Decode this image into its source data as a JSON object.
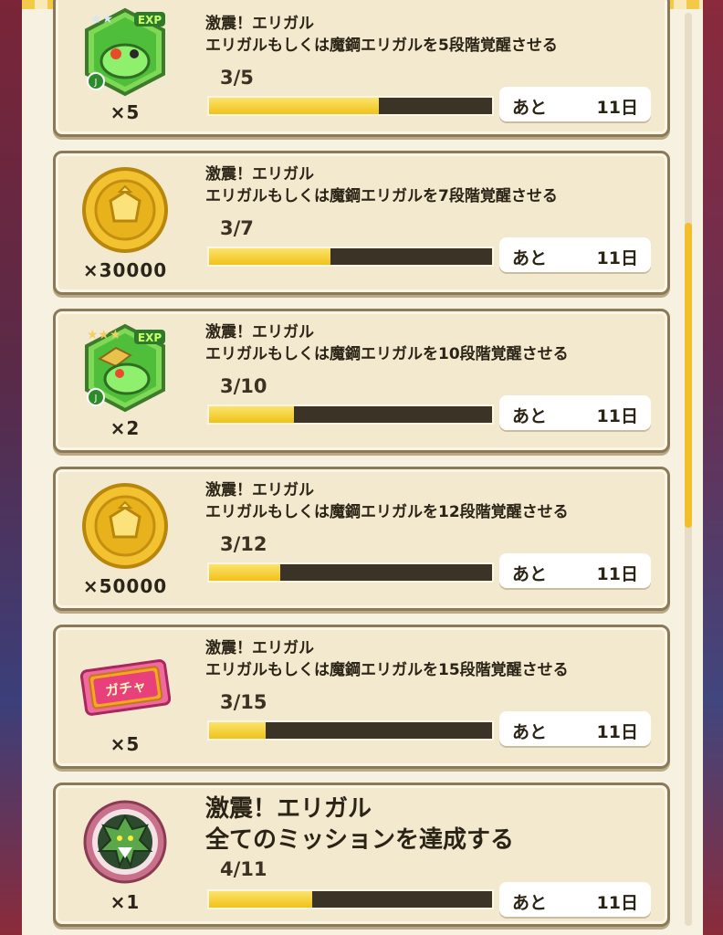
{
  "missions": [
    {
      "title": "激震！エリガル",
      "description": "エリガルもしくは魔鋼エリガルを5段階覚醒させる",
      "progress_text": "3/5",
      "progress": 0.6,
      "remaining_label": "あと",
      "remaining_days": "11日",
      "reward": {
        "type": "exp-monster-icon",
        "badge": "EXP",
        "quantity": "×5"
      }
    },
    {
      "title": "激震！エリガル",
      "description": "エリガルもしくは魔鋼エリガルを7段階覚醒させる",
      "progress_text": "3/7",
      "progress": 0.4286,
      "remaining_label": "あと",
      "remaining_days": "11日",
      "reward": {
        "type": "gold-coin-icon",
        "quantity": "×30000"
      }
    },
    {
      "title": "激震！エリガル",
      "description": "エリガルもしくは魔鋼エリガルを10段階覚醒させる",
      "progress_text": "3/10",
      "progress": 0.3,
      "remaining_label": "あと",
      "remaining_days": "11日",
      "reward": {
        "type": "exp-monster-icon",
        "badge": "EXP",
        "quantity": "×2"
      }
    },
    {
      "title": "激震！エリガル",
      "description": "エリガルもしくは魔鋼エリガルを12段階覚醒させる",
      "progress_text": "3/12",
      "progress": 0.25,
      "remaining_label": "あと",
      "remaining_days": "11日",
      "reward": {
        "type": "gold-coin-icon",
        "quantity": "×50000"
      }
    },
    {
      "title": "激震！エリガル",
      "description": "エリガルもしくは魔鋼エリガルを15段階覚醒させる",
      "progress_text": "3/15",
      "progress": 0.2,
      "remaining_label": "あと",
      "remaining_days": "11日",
      "reward": {
        "type": "gacha-ticket-icon",
        "ticket_text": "ガチャ",
        "quantity": "×5"
      }
    },
    {
      "title": "激震！エリガル",
      "description": "全てのミッションを達成する",
      "progress_text": "4/11",
      "progress": 0.3636,
      "remaining_label": "あと",
      "remaining_days": "11日",
      "reward": {
        "type": "monster-medal-icon",
        "quantity": "×1"
      }
    }
  ],
  "colors": {
    "bar_fill": "#f0c21a",
    "bar_track": "#3a3326",
    "card_bg": "#f3e9cf",
    "panel_bg": "#f7f1e2"
  }
}
